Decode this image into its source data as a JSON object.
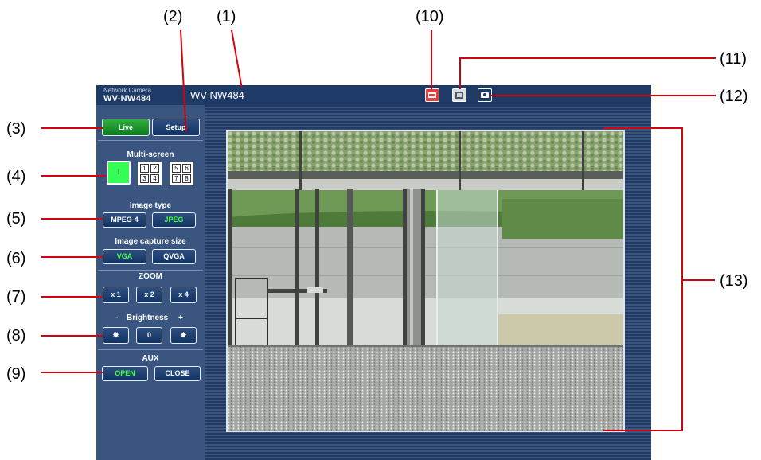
{
  "callouts": [
    "(1)",
    "(2)",
    "(3)",
    "(4)",
    "(5)",
    "(6)",
    "(7)",
    "(8)",
    "(9)",
    "(10)",
    "(11)",
    "(12)",
    "(13)"
  ],
  "header": {
    "brand_small": "Network Camera",
    "brand_model": "WV-NW484",
    "camera_title": "WV-NW484",
    "icons": [
      "recording-icon",
      "sd-card-icon",
      "snapshot-camera-icon"
    ]
  },
  "nav": {
    "live": "Live",
    "setup": "Setup"
  },
  "multiscreen": {
    "label": "Multi-screen",
    "options": [
      "I",
      "1 2 3 4",
      "5 6 7 8"
    ]
  },
  "image_type": {
    "label": "Image type",
    "mpeg4": "MPEG-4",
    "jpeg": "JPEG",
    "selected": "JPEG"
  },
  "capture_size": {
    "label": "Image capture size",
    "vga": "VGA",
    "qvga": "QVGA",
    "selected": "VGA"
  },
  "zoom": {
    "label": "ZOOM",
    "x1": "x 1",
    "x2": "x 2",
    "x4": "x 4"
  },
  "brightness": {
    "minus": "-",
    "label": "Brightness",
    "plus": "+",
    "reset": "0"
  },
  "aux": {
    "label": "AUX",
    "open": "OPEN",
    "close": "CLOSE"
  },
  "colors": {
    "accent_green": "#44ff44",
    "live_bg": "#1a8c2a",
    "panel": "#3a5680",
    "callout_line": "#d4000f"
  }
}
